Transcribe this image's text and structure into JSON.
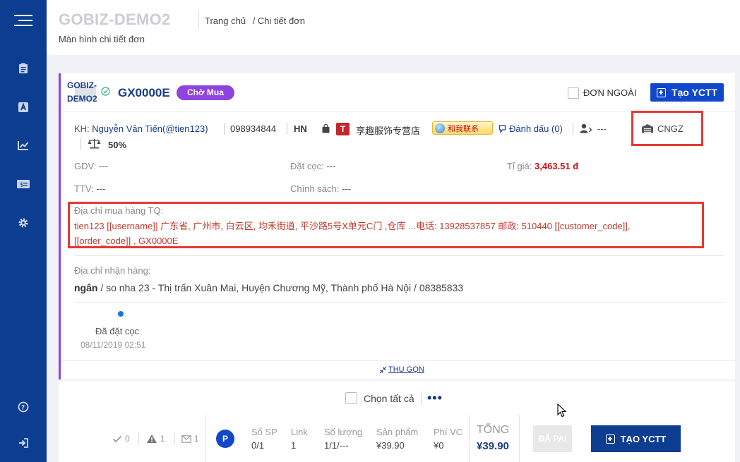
{
  "header": {
    "brand": "GOBIZ-DEMO2",
    "subtitle": "Màn hình chi tiết đơn",
    "breadcrumbs": [
      "Trang chủ",
      "/ Chi tiết đơn"
    ]
  },
  "order": {
    "shop_name": "GOBIZ-DEMO2",
    "code": "GX0000E",
    "status": "Chờ Mua",
    "external_label": "ĐƠN NGOÀI",
    "create_yctt_label": "Tạo YCTT",
    "customer_prefix": "KH:",
    "customer_name": "Nguyễn Văn Tiến(@tien123)",
    "phone": "098934844",
    "city": "HN",
    "store_initial": "T",
    "store_name": "享趣服饰专营店",
    "contact_label": "和我联系",
    "bookmark_label": "Đánh dấu (0)",
    "assignee": "---",
    "warehouse": "CNGZ",
    "ratio": "50%",
    "gdv_label": "GDV:",
    "gdv_value": "---",
    "deposit_label": "Đặt cọc:",
    "deposit_value": "---",
    "rate_label": "Tỉ giá:",
    "rate_value": "3,463.51 đ",
    "ttv_label": "TTV:",
    "ttv_value": "---",
    "policy_label": "Chính sách:",
    "policy_value": "---",
    "purchase_addr_label": "Địa chỉ mua hàng TQ:",
    "purchase_addr": "tien123 [[username]] 广东省, 广州市, 白云区, 均禾街道, 平沙路5号X单元C门 ,仓库 ...电话: 13928537857 邮政: 510440 [[customer_code]], [[order_code]] , GX0000E",
    "recv_addr_label": "Địa chỉ nhận hàng:",
    "recv_name": "ngân",
    "recv_addr": " / so nha 23 - Thị trấn Xuân Mai, Huyện Chương Mỹ, Thành phố Hà Nội / 08385833",
    "timeline_label": "Đã đặt cọc",
    "timeline_time": "08/11/2019 02:51",
    "collapse_label": "THU GỌN"
  },
  "bottom": {
    "select_all": "Chọn tất cả",
    "more": "•••",
    "stat_checks": "0",
    "stat_warnings": "1",
    "stat_messages": "1",
    "avatar_letter": "P",
    "cols": [
      {
        "label": "Số SP",
        "value": "0/1"
      },
      {
        "label": "Link",
        "value": "1"
      },
      {
        "label": "Số lượng",
        "value": "1/1/---"
      },
      {
        "label": "Sản phẩm",
        "value": "¥39.90"
      },
      {
        "label": "Phí VC",
        "value": "¥0"
      }
    ],
    "total_label": "TỔNG",
    "total_value": "¥39.90",
    "paid_label": "ĐÃ PAI",
    "create_yctt_label": "TẠO YCTT"
  },
  "colors": {
    "sidebar": "#0d3d91",
    "accent_purple": "#8e44e0",
    "primary_blue": "#1148c9",
    "highlight_red": "#e53935"
  },
  "icons": [
    "menu-icon",
    "clipboard-icon",
    "letter-a-icon",
    "chart-icon",
    "money-icon",
    "gear-icon",
    "help-icon",
    "logout-icon"
  ]
}
